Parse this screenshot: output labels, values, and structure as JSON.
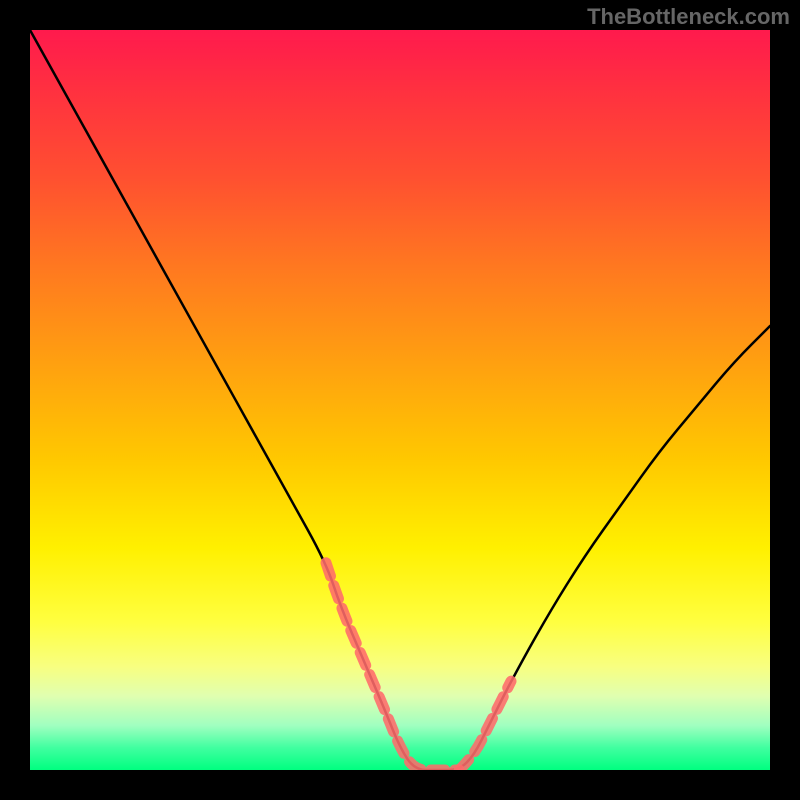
{
  "watermark": "TheBottleneck.com",
  "chart_data": {
    "type": "line",
    "title": "",
    "xlabel": "",
    "ylabel": "",
    "xlim": [
      0,
      100
    ],
    "ylim": [
      0,
      100
    ],
    "x": [
      0,
      5,
      10,
      15,
      20,
      25,
      30,
      35,
      40,
      42,
      45,
      48,
      50,
      52,
      55,
      58,
      60,
      62,
      65,
      70,
      75,
      80,
      85,
      90,
      95,
      100
    ],
    "values": [
      100,
      91,
      82,
      73,
      64,
      55,
      46,
      37,
      28,
      22,
      15,
      8,
      3,
      0,
      0,
      0,
      2,
      6,
      12,
      21,
      29,
      36,
      43,
      49,
      55,
      60
    ],
    "annotations": "Highlighted pink dotted segments near the trough between x≈40 and x≈65"
  }
}
